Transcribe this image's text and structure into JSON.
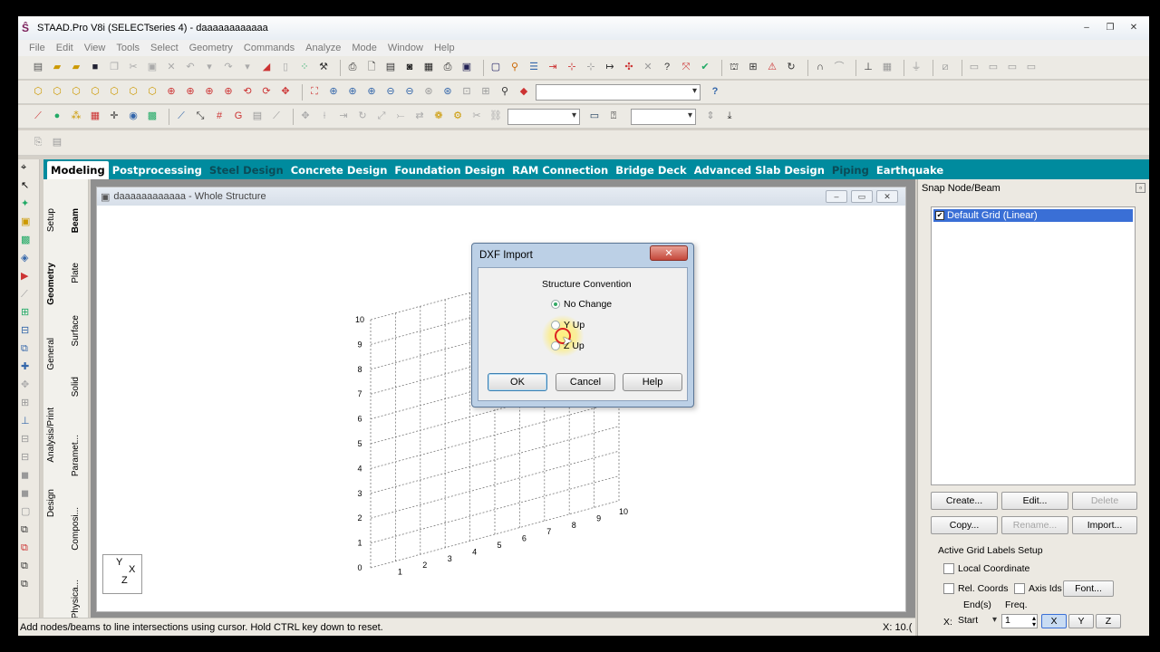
{
  "window": {
    "title": "STAAD.Pro V8i (SELECTseries 4) - daaaaaaaaaaaa",
    "controls": [
      "–",
      "❐",
      "✕"
    ]
  },
  "menu": [
    "File",
    "Edit",
    "View",
    "Tools",
    "Select",
    "Geometry",
    "Commands",
    "Analyze",
    "Mode",
    "Window",
    "Help"
  ],
  "toolbar": {
    "help_icon": "?"
  },
  "ribbon_tabs": [
    {
      "label": "Modeling",
      "state": "active"
    },
    {
      "label": "Postprocessing",
      "state": "normal"
    },
    {
      "label": "Steel Design",
      "state": "dim"
    },
    {
      "label": "Concrete Design",
      "state": "normal"
    },
    {
      "label": "Foundation Design",
      "state": "normal"
    },
    {
      "label": "RAM Connection",
      "state": "normal"
    },
    {
      "label": "Bridge Deck",
      "state": "normal"
    },
    {
      "label": "Advanced Slab Design",
      "state": "normal"
    },
    {
      "label": "Piping",
      "state": "dim"
    },
    {
      "label": "Earthquake",
      "state": "normal"
    }
  ],
  "side_tabs": {
    "outer": [
      "Setup",
      "Geometry",
      "General",
      "Analysis/Print",
      "Design"
    ],
    "inner": [
      "Beam",
      "Plate",
      "Surface",
      "Solid",
      "Paramet...",
      "Composi...",
      "Physica..."
    ]
  },
  "viewport": {
    "title": "daaaaaaaaaaaa - Whole Structure",
    "y_ticks": [
      "0",
      "1",
      "2",
      "3",
      "4",
      "5",
      "6",
      "7",
      "8",
      "9",
      "10"
    ],
    "x_ticks": [
      "1",
      "2",
      "3",
      "4",
      "5",
      "6",
      "7",
      "8",
      "9",
      "10"
    ],
    "triad": {
      "y": "Y",
      "x": "X",
      "z": "Z"
    }
  },
  "dialog": {
    "title": "DXF Import",
    "close": "✕",
    "group_label": "Structure Convention",
    "options": [
      {
        "label": "No Change",
        "selected": true
      },
      {
        "label": "Y Up",
        "selected": false
      },
      {
        "label": "Z Up",
        "selected": false
      }
    ],
    "ok": "OK",
    "cancel": "Cancel",
    "help": "Help"
  },
  "snap_panel": {
    "title": "Snap Node/Beam",
    "grid_item": "Default Grid (Linear)",
    "buttons": {
      "create": "Create...",
      "edit": "Edit...",
      "delete": "Delete",
      "copy": "Copy...",
      "rename": "Rename...",
      "import": "Import..."
    },
    "labels_setup": "Active Grid Labels Setup",
    "local_coordinate": "Local Coordinate",
    "rel_coords": "Rel. Coords",
    "axis_ids": "Axis Ids",
    "font": "Font...",
    "ends": "End(s)",
    "freq": "Freq.",
    "axis_prefix": "X:",
    "start": "Start",
    "freq_value": "1",
    "axis_x": "X",
    "axis_y": "Y",
    "axis_z": "Z"
  },
  "status": {
    "text": "Add nodes/beams to line intersections using cursor. Hold CTRL key down to reset.",
    "coord": "X:  10.("
  },
  "colors": {
    "ribbon": "#008b9e",
    "selection": "#3a6fd6",
    "dialog_frame": "#bcd0e6"
  }
}
